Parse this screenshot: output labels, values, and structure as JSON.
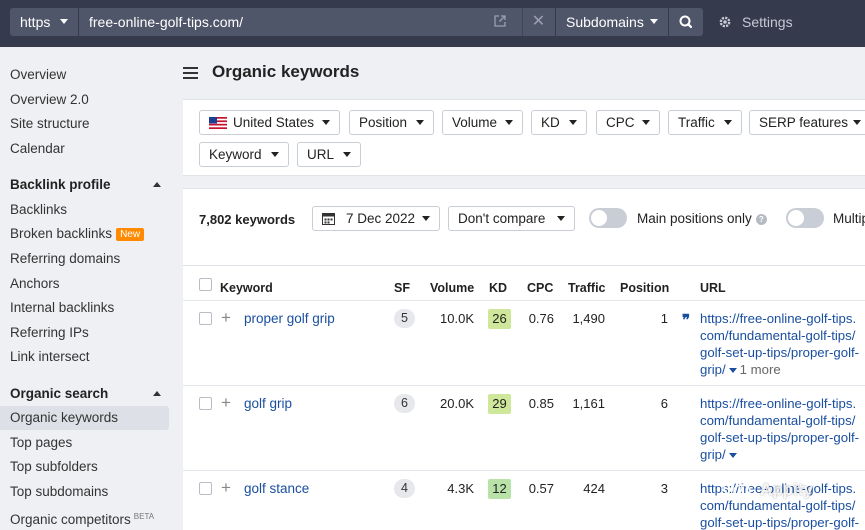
{
  "topbar": {
    "protocol": "https",
    "url": "free-online-golf-tips.com/",
    "mode": "Subdomains",
    "settings_label": "Settings"
  },
  "sidebar": {
    "top_items": [
      "Overview",
      "Overview 2.0",
      "Site structure",
      "Calendar"
    ],
    "backlink_heading": "Backlink profile",
    "backlink_items": [
      "Backlinks",
      "Broken backlinks",
      "Referring domains",
      "Anchors",
      "Internal backlinks",
      "Referring IPs",
      "Link intersect"
    ],
    "new_badge": "New",
    "organic_heading": "Organic search",
    "organic_items": [
      "Organic keywords",
      "Top pages",
      "Top subfolders",
      "Top subdomains",
      "Organic competitors"
    ],
    "beta_badge": "BETA"
  },
  "main": {
    "title": "Organic keywords",
    "filters": {
      "country": "United States",
      "position": "Position",
      "volume": "Volume",
      "kd": "KD",
      "cpc": "CPC",
      "traffic": "Traffic",
      "serp": "SERP features",
      "keyword": "Keyword",
      "url": "URL"
    },
    "controls": {
      "keyword_count": "7,802 keywords",
      "date": "7 Dec 2022",
      "compare": "Don't compare",
      "main_positions": "Main positions only",
      "multi": "Multip"
    },
    "table": {
      "headers": {
        "keyword": "Keyword",
        "sf": "SF",
        "volume": "Volume",
        "kd": "KD",
        "cpc": "CPC",
        "traffic": "Traffic",
        "position": "Position",
        "url": "URL"
      },
      "rows": [
        {
          "keyword": "proper golf grip",
          "sf": "5",
          "volume": "10.0K",
          "kd": "26",
          "cpc": "0.76",
          "traffic": "1,490",
          "position": "1",
          "url": "https://free-online-golf-tips.com/fundamental-golf-tips/golf-set-up-tips/proper-golf-grip/",
          "more": "1 more"
        },
        {
          "keyword": "golf grip",
          "sf": "6",
          "volume": "20.0K",
          "kd": "29",
          "cpc": "0.85",
          "traffic": "1,161",
          "position": "6",
          "url": "https://free-online-golf-tips.com/fundamental-golf-tips/golf-set-up-tips/proper-golf-grip/",
          "more": ""
        },
        {
          "keyword": "golf stance",
          "sf": "4",
          "volume": "4.3K",
          "kd": "12",
          "cpc": "0.57",
          "traffic": "424",
          "position": "3",
          "url": "https://free-online-golf-tips.com/fundamental-golf-tips/golf-set-up-tips/proper-golf-stance/",
          "more": ""
        }
      ]
    }
  },
  "watermark": "Appity",
  "colors": {
    "topbar_bg": "#353a4d",
    "link": "#1a4fa0",
    "new_badge": "#ff8a00",
    "kd_green_light": "#cfe79a",
    "kd_green": "#b9e2a8"
  }
}
